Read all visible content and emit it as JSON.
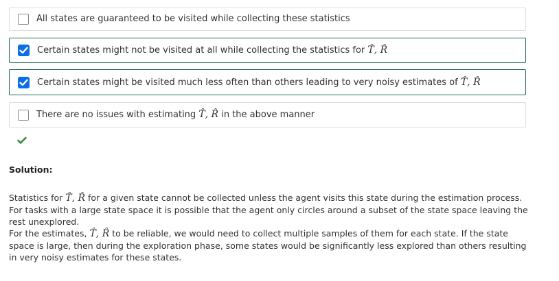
{
  "options": [
    {
      "prefix": "All states are guaranteed to be visited while collecting these statistics",
      "math": "",
      "suffix": "",
      "checked": false
    },
    {
      "prefix": "Certain states might not be visited at all while collecting the statistics for ",
      "math": "T̂, R̂",
      "suffix": "",
      "checked": true
    },
    {
      "prefix": "Certain states might be visited much less often than others leading to very noisy estimates of ",
      "math": "T̂, R̂",
      "suffix": "",
      "checked": true
    },
    {
      "prefix": "There are no issues with estimating ",
      "math": "T̂, R̂",
      "suffix": " in the above manner",
      "checked": false
    }
  ],
  "result_icon": "check-icon",
  "solution": {
    "title": "Solution:",
    "p1_prefix": "Statistics for ",
    "p1_math": "T̂, R̂",
    "p1_suffix": " for a given state cannot be collected unless the agent visits this state during the estimation process. For tasks with a large state space it is possible that the agent only circles around a subset of the state space leaving the rest unexplored.",
    "p2_prefix": "For the estimates, ",
    "p2_math": "T̂, R̂",
    "p2_suffix": " to be reliable, we would need to collect multiple samples of them for each state. If the state space is large, then during the exploration phase, some states would be significantly less explored than others resulting in very noisy estimates for these states."
  },
  "colors": {
    "selected_border": "#1f6b53",
    "checkbox_checked": "#0a6ee8",
    "correct_check": "#2e8b3a"
  }
}
